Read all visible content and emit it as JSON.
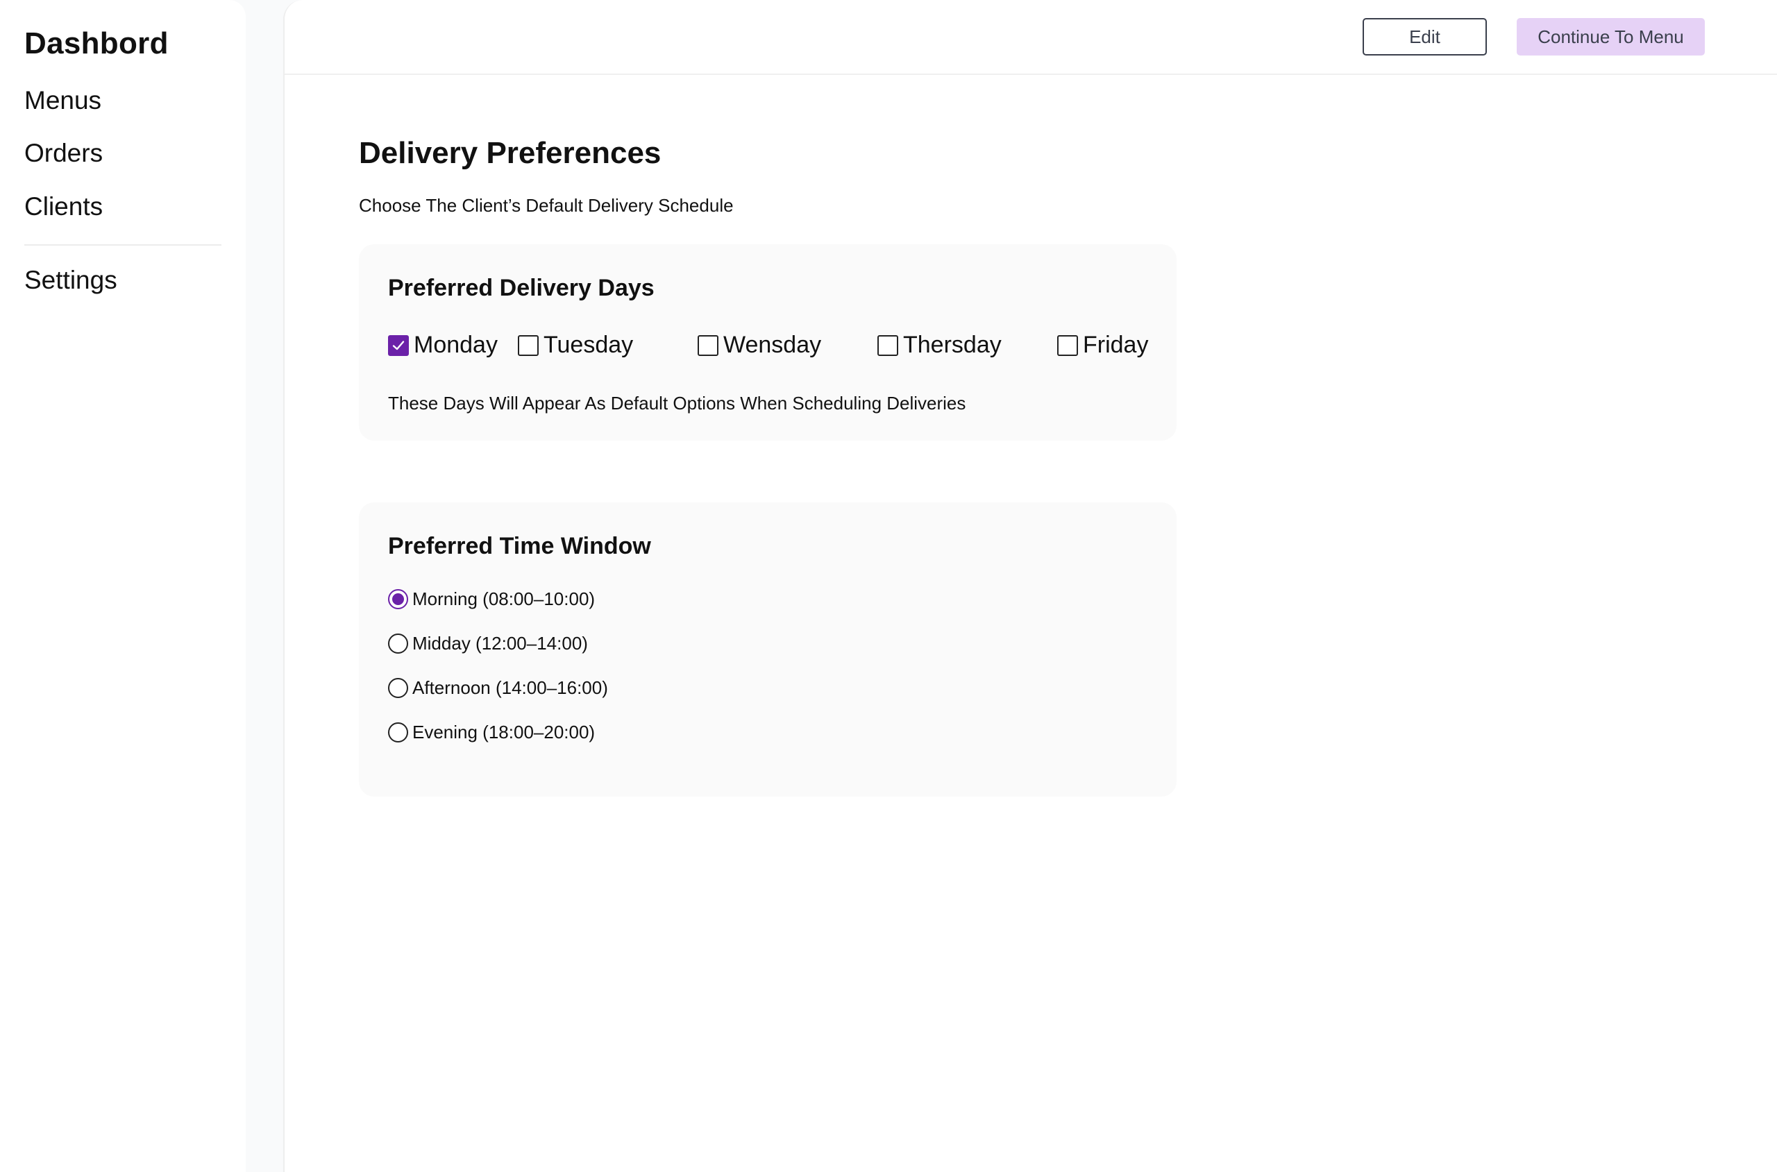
{
  "sidebar": {
    "brand": "Dashbord",
    "items": [
      {
        "label": "Menus"
      },
      {
        "label": "Orders"
      },
      {
        "label": "Clients"
      },
      {
        "label": "Settings"
      }
    ]
  },
  "toolbar": {
    "edit_label": "Edit",
    "continue_label": "Continue To Menu"
  },
  "page": {
    "title": "Delivery Preferences",
    "subtitle": "Choose The Client’s Default Delivery Schedule"
  },
  "delivery_days": {
    "title": "Preferred Delivery Days",
    "days": [
      {
        "label": "Monday",
        "checked": true
      },
      {
        "label": "Tuesday",
        "checked": false
      },
      {
        "label": "Wensday",
        "checked": false
      },
      {
        "label": "Thersday",
        "checked": false
      },
      {
        "label": "Friday",
        "checked": false
      }
    ],
    "note": "These Days Will Appear As Default Options When Scheduling Deliveries"
  },
  "time_window": {
    "title": "Preferred Time Window",
    "options": [
      {
        "label": "Morning (08:00–10:00)",
        "selected": true
      },
      {
        "label": "Midday (12:00–14:00)",
        "selected": false
      },
      {
        "label": "Afternoon (14:00–16:00)",
        "selected": false
      },
      {
        "label": "Evening (18:00–20:00)",
        "selected": false
      }
    ]
  },
  "colors": {
    "accent": "#6b21a8",
    "continue_button_bg": "#e6d2f6",
    "page_bg": "#f9fafb"
  }
}
